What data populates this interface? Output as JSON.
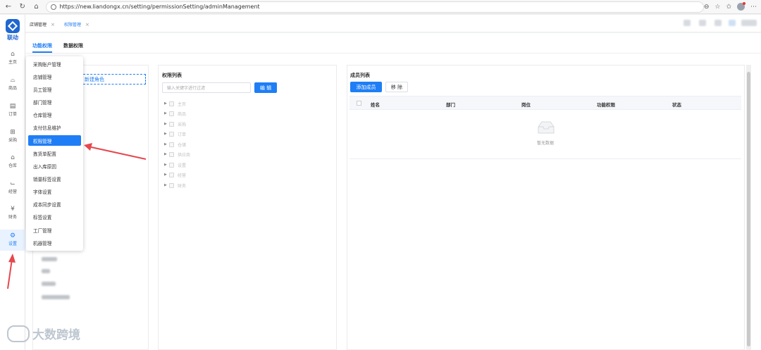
{
  "browser": {
    "url": "https://new.liandongx.cn/setting/permissionSetting/adminManagement"
  },
  "app": {
    "logo_text": "联动"
  },
  "appnav": {
    "items": [
      {
        "label": "主页",
        "icon": "home-icon"
      },
      {
        "label": "商品",
        "icon": "bag-icon"
      },
      {
        "label": "订单",
        "icon": "document-icon"
      },
      {
        "label": "采购",
        "icon": "cart-icon"
      },
      {
        "label": "仓库",
        "icon": "warehouse-icon"
      },
      {
        "label": "经营",
        "icon": "chart-icon"
      },
      {
        "label": "财务",
        "icon": "yen-icon"
      },
      {
        "label": "设置",
        "icon": "gear-icon"
      }
    ],
    "active": "设置"
  },
  "tabs": [
    {
      "label": "店铺管理",
      "active": false
    },
    {
      "label": "权限管理",
      "active": true
    }
  ],
  "subtabs": [
    {
      "label": "功能权限",
      "active": true
    },
    {
      "label": "数据权限",
      "active": false
    }
  ],
  "role_panel": {
    "new_role_label": "新建角色"
  },
  "permission_panel": {
    "title": "权限列表",
    "search_placeholder": "输入关键字进行过滤",
    "edit_label": "编 辑",
    "tree": [
      "主页",
      "商品",
      "采购",
      "订单",
      "仓储",
      "供应商",
      "设置",
      "经营",
      "财务"
    ]
  },
  "member_panel": {
    "title": "成员列表",
    "add_label": "添加成员",
    "remove_label": "移 除",
    "columns": [
      "姓名",
      "部门",
      "岗位",
      "功能权限",
      "状态"
    ],
    "empty_text": "暂无数据"
  },
  "menu": {
    "items": [
      "采购账户管理",
      "店铺管理",
      "员工管理",
      "部门管理",
      "仓库管理",
      "支付信息维护",
      "权限管理",
      "拣货单配置",
      "出入库原因",
      "销量标签设置",
      "字体设置",
      "成本同步设置",
      "标签设置",
      "工厂管理",
      "机器管理"
    ],
    "active": "权限管理"
  },
  "watermark": {
    "text": "大数跨境"
  },
  "colors": {
    "primary": "#1f7ef5",
    "annotation_arrow": "#e5484d"
  }
}
